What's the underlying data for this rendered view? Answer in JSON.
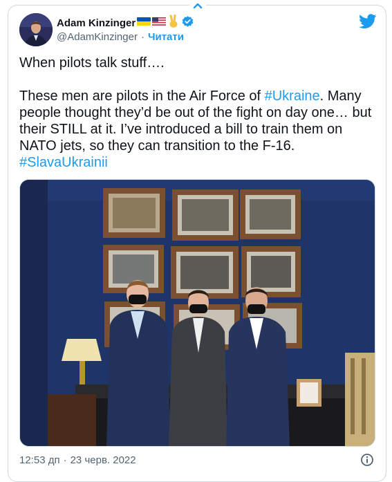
{
  "author": {
    "name": "Adam Kinzinger",
    "handle": "@AdamKinzinger",
    "separator": "·",
    "follow_label": "Читати",
    "badges": [
      "ukraine-flag-icon",
      "us-flag-icon",
      "victory-hand-icon",
      "verified-badge-icon"
    ]
  },
  "tweet": {
    "line1": "When pilots talk stuff….",
    "line2_a": "These men are pilots in the Air Force of ",
    "line2_hashtag": "#Ukraine",
    "line2_b": ".  Many people thought they’d be out of the fight on day one… but their STILL at it.  I’ve introduced a bill to train them on NATO jets, so they can transition to the F-16.",
    "hashtag2": "#SlavaUkrainii"
  },
  "meta": {
    "time": "12:53 дп",
    "separator": "·",
    "date": "23 черв. 2022"
  },
  "colors": {
    "accent": "#1d9bf0",
    "text": "#0f1419",
    "muted": "#536471",
    "border": "#cfd9de"
  }
}
